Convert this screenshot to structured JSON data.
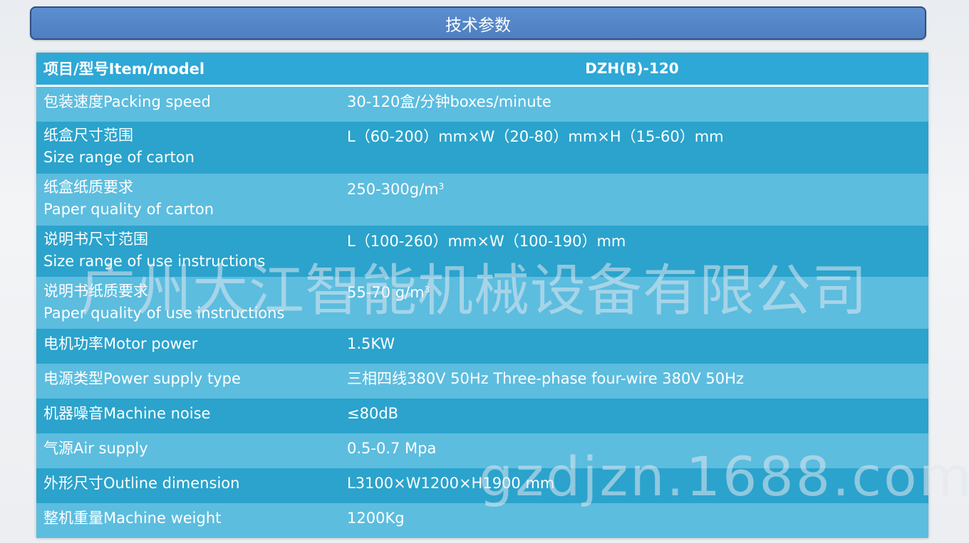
{
  "title": "技术参数",
  "header": {
    "col1": "项目/型号Item/model",
    "col2": "DZH(B)-120"
  },
  "rows": [
    {
      "label": "包装速度Packing speed",
      "value": "30-120盒/分钟boxes/minute"
    },
    {
      "label": "纸盒尺寸范围",
      "label2": "Size range of carton",
      "value": "L（60-200）mm×W（20-80）mm×H（15-60）mm"
    },
    {
      "label": "纸盒纸质要求",
      "label2": "Paper quality of carton",
      "value": "250-300g/m",
      "value_sup": "3"
    },
    {
      "label": "说明书尺寸范围",
      "label2": "Size range of use instructions",
      "value": "L（100-260）mm×W（100-190）mm"
    },
    {
      "label": "说明书纸质要求",
      "label2": "Paper quality of use instructions",
      "value": "55-70 g/m",
      "value_sup": "3"
    },
    {
      "label": "电机功率Motor power",
      "value": "1.5KW"
    },
    {
      "label": "电源类型Power supply type",
      "value": "三相四线380V 50Hz Three-phase four-wire 380V 50Hz"
    },
    {
      "label": "机器噪音Machine noise",
      "value": "≤80dB"
    },
    {
      "label": "气源Air supply",
      "value": "0.5-0.7 Mpa"
    },
    {
      "label": "外形尺寸Outline dimension",
      "value": "L3100×W1200×H1900 mm"
    },
    {
      "label": "整机重量Machine weight",
      "value": "1200Kg"
    }
  ],
  "watermark": {
    "company": "广州大江智能机械设备有限公司",
    "site": "gzdjzn.1688.com"
  },
  "colors": {
    "title_bg": "#5187c8",
    "header_bg": "#2ea8d6",
    "row_light": "#5cbddf",
    "row_dark": "#2ba3cc"
  }
}
